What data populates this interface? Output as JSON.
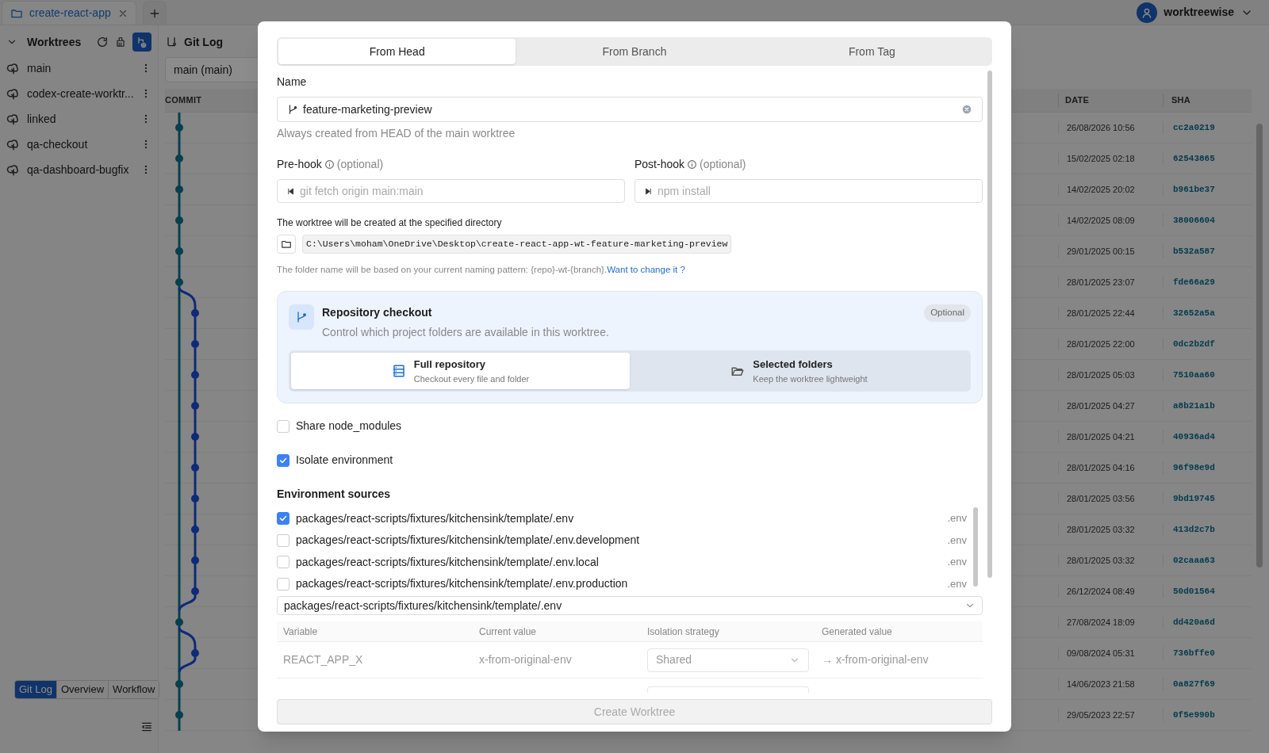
{
  "tab_bar": {
    "tabs": [
      {
        "label": "create-react-app",
        "selected": true
      }
    ]
  },
  "account": {
    "name": "worktreewise"
  },
  "sidebar": {
    "title": "Worktrees",
    "items": [
      {
        "label": "main"
      },
      {
        "label": "codex-create-worktr..."
      },
      {
        "label": "linked"
      },
      {
        "label": "qa-checkout"
      },
      {
        "label": "qa-dashboard-bugfix"
      }
    ],
    "view_switch": [
      {
        "label": "Git Log",
        "selected": true
      },
      {
        "label": "Overview",
        "selected": false
      },
      {
        "label": "Workflow",
        "selected": false
      }
    ]
  },
  "git_log": {
    "title": "Git Log",
    "branch_select": "main (main)",
    "columns": [
      "COMMIT",
      "DATE",
      "SHA"
    ],
    "rows": [
      {
        "date": "26/08/2026 10:56",
        "sha": "cc2a0219"
      },
      {
        "date": "15/02/2025 02:18",
        "sha": "62543865"
      },
      {
        "date": "14/02/2025 20:02",
        "sha": "b961be37"
      },
      {
        "date": "14/02/2025 08:09",
        "sha": "38006604"
      },
      {
        "date": "29/01/2025 00:15",
        "sha": "b532a587"
      },
      {
        "date": "28/01/2025 23:07",
        "sha": "fde66a29"
      },
      {
        "date": "28/01/2025 22:44",
        "sha": "32652a5a"
      },
      {
        "date": "28/01/2025 22:00",
        "sha": "0dc2b2df"
      },
      {
        "date": "28/01/2025 05:03",
        "sha": "7510aa60"
      },
      {
        "date": "28/01/2025 04:27",
        "sha": "a8b21a1b"
      },
      {
        "date": "28/01/2025 04:21",
        "sha": "40936ad4"
      },
      {
        "date": "28/01/2025 04:16",
        "sha": "96f98e9d"
      },
      {
        "date": "28/01/2025 03:56",
        "sha": "9bd19745"
      },
      {
        "date": "28/01/2025 03:32",
        "sha": "413d2c7b"
      },
      {
        "date": "28/01/2025 03:32",
        "sha": "02caaa63"
      },
      {
        "date": "26/12/2024 08:49",
        "sha": "50d01564"
      },
      {
        "date": "27/08/2024 18:09",
        "sha": "dd420a6d"
      },
      {
        "date": "09/08/2024 05:31",
        "sha": "736bffe0"
      },
      {
        "date": "14/06/2023 21:58",
        "sha": "0a827f69"
      },
      {
        "date": "29/05/2023 22:57",
        "sha": "0f5e990b"
      }
    ]
  },
  "dialog": {
    "tabs": [
      {
        "label": "From Head",
        "selected": true
      },
      {
        "label": "From Branch",
        "selected": false
      },
      {
        "label": "From Tag",
        "selected": false
      }
    ],
    "name_label": "Name",
    "name_value": "feature-marketing-preview",
    "name_hint": "Always created from HEAD of the main worktree",
    "hooks": [
      {
        "label": "Pre-hook",
        "optional": "(optional)",
        "placeholder": "git fetch origin main:main"
      },
      {
        "label": "Post-hook",
        "optional": "(optional)",
        "placeholder": "npm install"
      }
    ],
    "location_label": "The worktree will be created at the specified directory",
    "path": "C:\\Users\\moham\\OneDrive\\Desktop\\create-react-app-wt-feature-marketing-preview",
    "pattern_note": "The folder name will be based on your current naming pattern: {repo}-wt-{branch}.",
    "pattern_link": "Want to change it ?",
    "checkout": {
      "title": "Repository checkout",
      "description": "Control which project folders are available in this worktree.",
      "badge": "Optional",
      "options": [
        {
          "label": "Full repository",
          "sub": "Checkout every file and folder",
          "selected": true
        },
        {
          "label": "Selected folders",
          "sub": "Keep the worktree lightweight",
          "selected": false
        }
      ]
    },
    "options": [
      {
        "label": "Share node_modules",
        "checked": false
      },
      {
        "label": "Isolate environment",
        "checked": true
      }
    ],
    "env_sources": {
      "title": "Environment sources",
      "items": [
        {
          "path": "packages/react-scripts/fixtures/kitchensink/template/.env",
          "ext": ".env",
          "checked": true
        },
        {
          "path": "packages/react-scripts/fixtures/kitchensink/template/.env.development",
          "ext": ".env",
          "checked": false
        },
        {
          "path": "packages/react-scripts/fixtures/kitchensink/template/.env.local",
          "ext": ".env",
          "checked": false
        },
        {
          "path": "packages/react-scripts/fixtures/kitchensink/template/.env.production",
          "ext": ".env",
          "checked": false
        }
      ]
    },
    "env_file_select": "packages/react-scripts/fixtures/kitchensink/template/.env",
    "env_table": {
      "columns": [
        "Variable",
        "Current value",
        "Isolation strategy",
        "Generated value"
      ],
      "rows": [
        {
          "variable": "REACT_APP_X",
          "current": "x-from-original-env",
          "strategy": "Shared",
          "generated": "→ x-from-original-env"
        }
      ]
    },
    "submit": {
      "label": "Create Worktree",
      "disabled": true
    }
  }
}
